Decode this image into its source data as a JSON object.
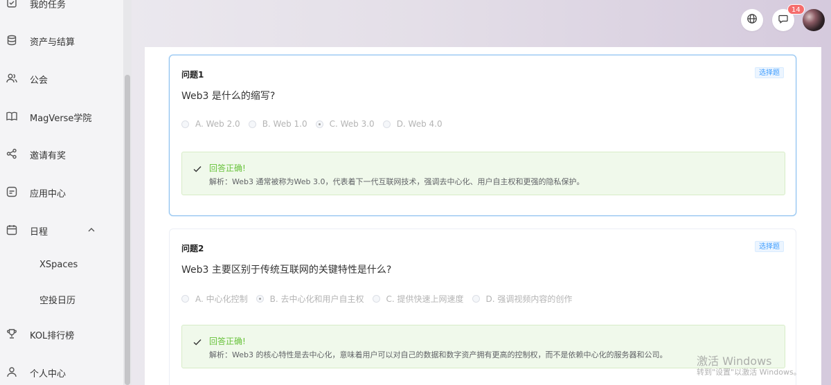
{
  "sidebar": {
    "items": [
      {
        "label": "我的任务",
        "icon": "task-icon"
      },
      {
        "label": "资产与结算",
        "icon": "database-icon"
      },
      {
        "label": "公会",
        "icon": "users-icon"
      },
      {
        "label": "MagVerse学院",
        "icon": "book-icon"
      },
      {
        "label": "邀请有奖",
        "icon": "share-icon"
      },
      {
        "label": "应用中心",
        "icon": "app-center-icon"
      },
      {
        "label": "日程",
        "icon": "calendar-icon",
        "expanded": true
      },
      {
        "label": "KOL排行榜",
        "icon": "trophy-icon"
      },
      {
        "label": "个人中心",
        "icon": "user-icon"
      }
    ],
    "schedule_subitems": [
      "XSpaces",
      "空投日历"
    ]
  },
  "header": {
    "language_icon": "globe-icon",
    "message_icon": "message-icon",
    "message_badge": "14"
  },
  "questions": [
    {
      "number": "问题1",
      "type_tag": "选择题",
      "text": "Web3 是什么的缩写?",
      "options": [
        "A. Web 2.0",
        "B. Web 1.0",
        "C. Web 3.0",
        "D. Web 4.0"
      ],
      "selected": 2,
      "result_title": "回答正确!",
      "explanation": "解析：Web3 通常被称为Web 3.0，代表着下一代互联网技术，强调去中心化、用户自主权和更强的隐私保护。"
    },
    {
      "number": "问题2",
      "type_tag": "选择题",
      "text": "Web3 主要区别于传统互联网的关键特性是什么?",
      "options": [
        "A. 中心化控制",
        "B. 去中心化和用户自主权",
        "C. 提供快速上网速度",
        "D. 强调视频内容的创作"
      ],
      "selected": 1,
      "result_title": "回答正确!",
      "explanation": "解析：Web3 的核心特性是去中心化，意味着用户可以对自己的数据和数字资产拥有更高的控制权，而不是依赖中心化的服务器和公司。"
    }
  ],
  "watermark": {
    "line1": "激活 Windows",
    "line2": "转到\"设置\"以激活 Windows。"
  },
  "colors": {
    "accent": "#409eff",
    "success": "#67c23a",
    "badge": "#f56c6c"
  }
}
